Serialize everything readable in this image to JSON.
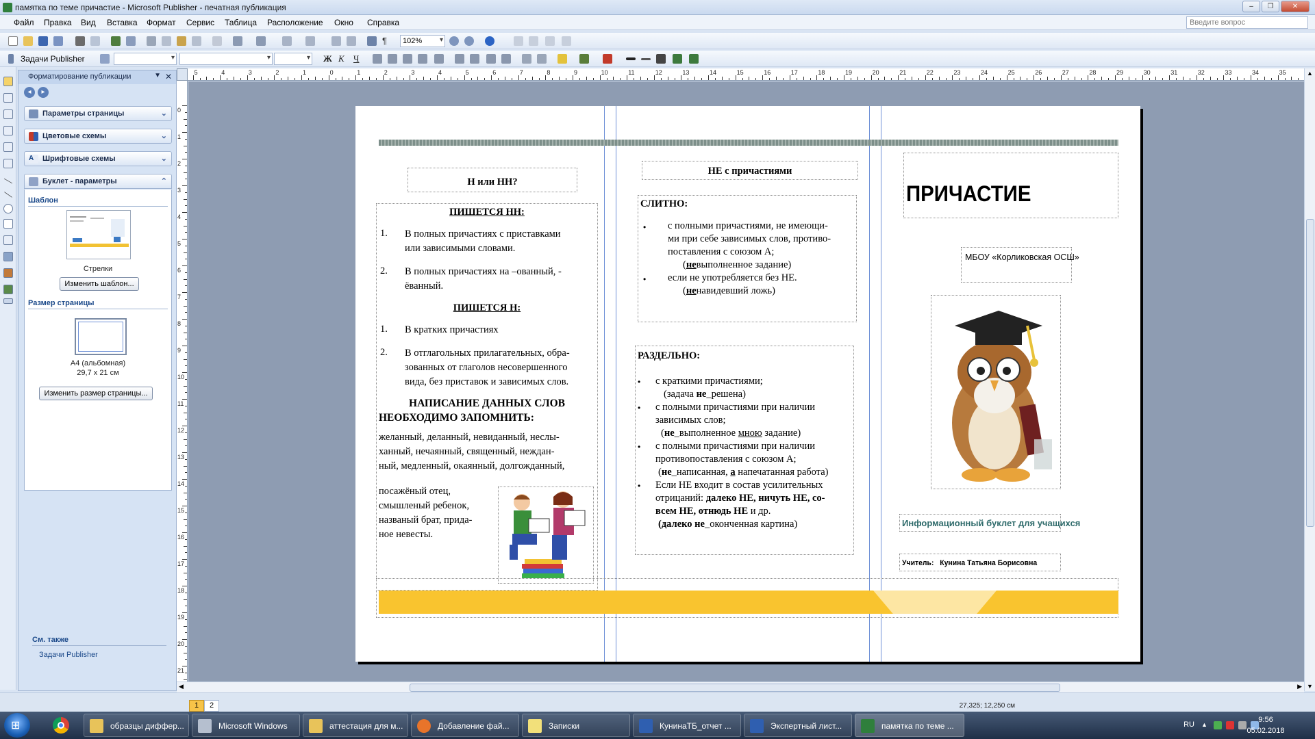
{
  "window": {
    "title": "памятка по теме причастие - Microsoft Publisher - печатная публикация",
    "buttons": {
      "minimize": "‒",
      "maximize": "❐",
      "close": "✕"
    }
  },
  "menu": {
    "items": [
      "Файл",
      "Правка",
      "Вид",
      "Вставка",
      "Формат",
      "Сервис",
      "Таблица",
      "Расположение",
      "Окно",
      "Справка"
    ],
    "help_placeholder": "Введите вопрос"
  },
  "toolbar": {
    "zoom": "102%",
    "tasks_label": "Задачи Publisher",
    "format_buttons": {
      "bold": "Ж",
      "italic": "К",
      "underline": "Ч"
    }
  },
  "taskpane": {
    "title": "Форматирование публикации",
    "sections": [
      "Параметры страницы",
      "Цветовые схемы",
      "Шрифтовые схемы",
      "Буклет - параметры"
    ],
    "template_label": "Шаблон",
    "template_name": "Стрелки",
    "change_template_button": "Изменить шаблон...",
    "page_size_label": "Размер страницы",
    "page_size_name": "A4 (альбомная)",
    "page_size_dims": "29,7 x 21 см",
    "change_size_button": "Изменить размер страницы...",
    "see_also_label": "См. также",
    "see_also_link": "Задачи Publisher"
  },
  "rulers": {
    "horizontal": [
      "6",
      "5",
      "4",
      "3",
      "2",
      "1",
      "0",
      "1",
      "2",
      "3",
      "4",
      "5",
      "6",
      "7",
      "8",
      "9",
      "10",
      "11",
      "12",
      "13",
      "14",
      "15",
      "16",
      "17",
      "18",
      "19",
      "20",
      "21",
      "22",
      "23",
      "24",
      "25",
      "26",
      "27",
      "28",
      "29",
      "30",
      "31",
      "32",
      "33",
      "34",
      "35"
    ],
    "vertical": [
      "0",
      "1",
      "2",
      "3",
      "4",
      "5",
      "6",
      "7",
      "8",
      "9",
      "10",
      "11",
      "12",
      "13",
      "14",
      "15",
      "16",
      "17",
      "18",
      "19",
      "20",
      "21"
    ]
  },
  "doc": {
    "col1": {
      "heading": "Н или НН?",
      "nn_title": "ПИШЕТСЯ НН:",
      "nn_items": [
        {
          "num": "1.",
          "lines": [
            "В полных причастиях с приставками",
            "или зависимыми словами."
          ]
        },
        {
          "num": "2.",
          "lines": [
            "В полных причастиях на –ованный,  -",
            "ёванный."
          ]
        }
      ],
      "n_title": "ПИШЕТСЯ Н:",
      "n_items": [
        {
          "num": "1.",
          "lines": [
            "В кратких причастиях"
          ]
        },
        {
          "num": "2.",
          "lines": [
            "В отглагольных прилагательных, обра-",
            "зованных от глаголов несовершенного",
            "вида, без приставок и зависимых слов."
          ]
        }
      ],
      "remember": [
        "НАПИСАНИЕ ДАННЫХ СЛОВ",
        "НЕОБХОДИМО ЗАПОМНИТЬ:"
      ],
      "words": [
        "желанный, деланный, невиданный, неслы-",
        "ханный, нечаянный, священный, неждан-",
        "ный, медленный, окаянный, долгожданный,"
      ],
      "words2": [
        " посажёный отец,",
        "смышленый ребенок,",
        "названый брат, прида-",
        "ное невесты."
      ]
    },
    "col2": {
      "heading": "НЕ с причастиями",
      "together_title": "СЛИТНО:",
      "together_1": [
        "с полными причастиями, не имеющи-",
        "ми при себе зависимых слов, противо-",
        "поставления с союзом А;"
      ],
      "together_1_ex_pre": "",
      "together_1_ex_bold": "не",
      "together_1_ex_post": "выполненное задание)",
      "together_2": "если не употребляется без НЕ.",
      "together_2_ex_bold": "не",
      "together_2_ex_post": "навидевший ложь)",
      "apart_title": "РАЗДЕЛЬНО:",
      "apart_1": "с краткими причастиями;",
      "apart_1_ex_pre": "(задача ",
      "apart_1_ex_bold": "не",
      "apart_1_ex_post": "_решена)",
      "apart_2": [
        "с полными причастиями при наличии",
        "зависимых слов;"
      ],
      "apart_2_ex_bold": "не",
      "apart_2_ex_mid": "_выполненное ",
      "apart_2_ex_u": "мною",
      "apart_2_ex_post": " задание)",
      "apart_3": [
        "с полными причастиями при наличии",
        "противопоставления с союзом А;"
      ],
      "apart_3_ex_bold": "не",
      "apart_3_ex_mid": "_написанная, ",
      "apart_3_ex_bold2": "а",
      "apart_3_ex_post": " напечатанная работа)",
      "apart_4_pre": "Если НЕ входит в состав  усилительных",
      "apart_4_l2_pre": "отрицаний: ",
      "apart_4_l2_bold": "далеко НЕ, ничуть НЕ, со-",
      "apart_4_l3_bold": "всем НЕ, отнюдь НЕ",
      "apart_4_l3_post": " и др.",
      "apart_4_ex_bold": "далеко не",
      "apart_4_ex_post": "_окончен­ная картина)"
    },
    "col3": {
      "title": "ПРИЧАСТИЕ",
      "school": "МБОУ «Корликовская ОСШ»",
      "subtitle": "Информационный буклет для учащихся",
      "teacher_label": "Учитель:",
      "teacher_name": "Кунина Татьяна Борисовна"
    }
  },
  "status": {
    "pages": [
      "1",
      "2"
    ],
    "coords": "27,325; 12,250 см"
  },
  "taskbar": {
    "tasks": [
      "образцы диффер...",
      "Microsoft Windows",
      "аттестация для м...",
      "Добавление фай...",
      "Записки",
      "КунинаТБ_отчет ...",
      "Экспертный лист...",
      "памятка по теме ..."
    ],
    "lang": "RU",
    "time": "9:56",
    "date": "05.02.2018"
  },
  "colors": {
    "accent_yellow": "#f9c42f",
    "band_gray": "#7d8f8a",
    "guide_blue": "#6d8fd6",
    "subtitle_teal": "#2f6b6b"
  }
}
